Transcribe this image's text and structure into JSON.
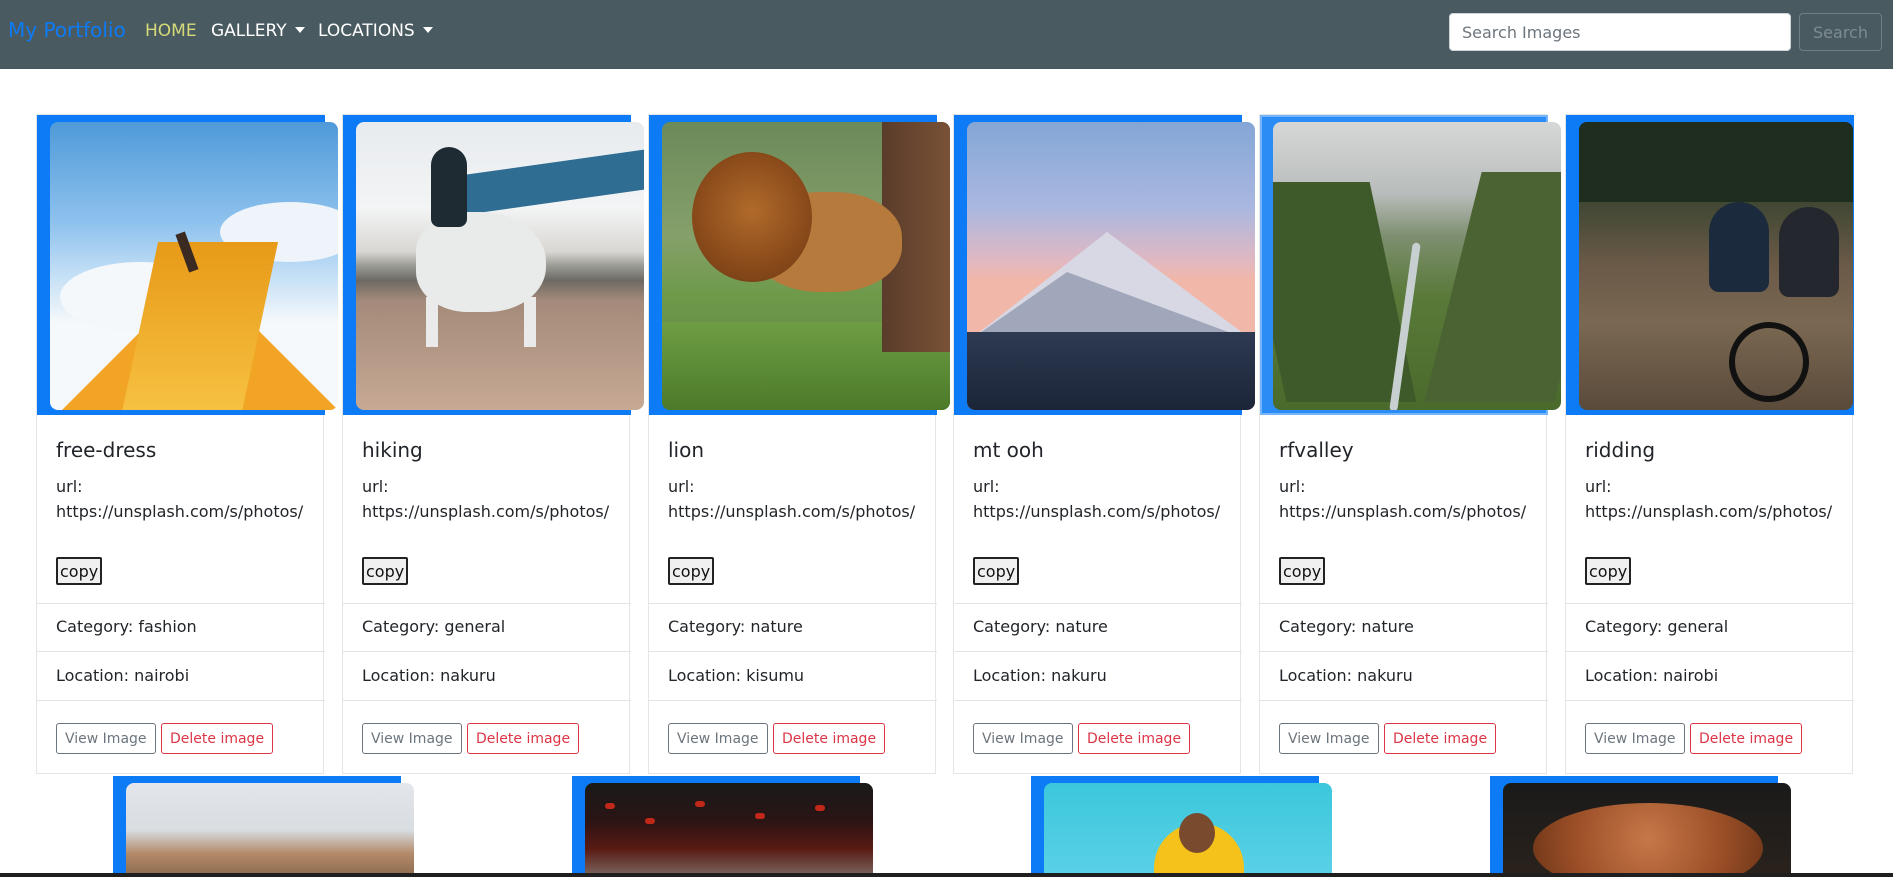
{
  "nav": {
    "brand": "My Portfolio",
    "items": [
      {
        "label": "HOME",
        "active": true
      },
      {
        "label": "GALLERY",
        "dropdown": true
      },
      {
        "label": "LOCATIONS",
        "dropdown": true
      }
    ],
    "search_placeholder": "Search Images",
    "search_button": "Search"
  },
  "cards": [
    {
      "title": "free-dress",
      "url_label": "url:",
      "url": "https://unsplash.com/s/photos/",
      "copy": "copy",
      "category": "Category: fashion",
      "location": "Location: nairobi",
      "view": "View Image",
      "delete": "Delete image"
    },
    {
      "title": "hiking",
      "url_label": "url:",
      "url": "https://unsplash.com/s/photos/",
      "copy": "copy",
      "category": "Category: general",
      "location": "Location: nakuru",
      "view": "View Image",
      "delete": "Delete image"
    },
    {
      "title": "lion",
      "url_label": "url:",
      "url": "https://unsplash.com/s/photos/",
      "copy": "copy",
      "category": "Category: nature",
      "location": "Location: kisumu",
      "view": "View Image",
      "delete": "Delete image"
    },
    {
      "title": "mt ooh",
      "url_label": "url:",
      "url": "https://unsplash.com/s/photos/",
      "copy": "copy",
      "category": "Category: nature",
      "location": "Location: nakuru",
      "view": "View Image",
      "delete": "Delete image"
    },
    {
      "title": "rfvalley",
      "url_label": "url:",
      "url": "https://unsplash.com/s/photos/",
      "copy": "copy",
      "category": "Category: nature",
      "location": "Location: nakuru",
      "view": "View Image",
      "delete": "Delete image"
    },
    {
      "title": "ridding",
      "url_label": "url:",
      "url": "https://unsplash.com/s/photos/",
      "copy": "copy",
      "category": "Category: general",
      "location": "Location: nairobi",
      "view": "View Image",
      "delete": "Delete image"
    }
  ],
  "colors": {
    "navbar": "#495a61",
    "brand": "#0d7bf5",
    "active_nav": "#d6db79",
    "card_accent": "#0d7bf5",
    "danger": "#dc3545",
    "secondary": "#6c757d"
  }
}
